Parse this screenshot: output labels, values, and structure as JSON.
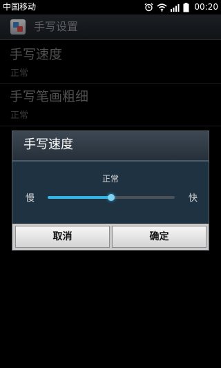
{
  "status_bar": {
    "carrier": "中国移动",
    "time": "00:20",
    "icons": [
      "alarm-icon",
      "wifi-icon",
      "signal-icon",
      "battery-icon"
    ]
  },
  "title_bar": {
    "title": "手写设置",
    "icon": "app-icon"
  },
  "preferences": [
    {
      "title": "手写速度",
      "summary": "正常"
    },
    {
      "title": "手写笔画粗细",
      "summary": "正常"
    }
  ],
  "dialog": {
    "title": "手写速度",
    "current_value": "正常",
    "min_label": "慢",
    "max_label": "快",
    "slider_fraction": 0.5,
    "cancel_label": "取消",
    "ok_label": "确定"
  },
  "colors": {
    "accent": "#33b5e5",
    "dialog_body": "#1f3242"
  }
}
